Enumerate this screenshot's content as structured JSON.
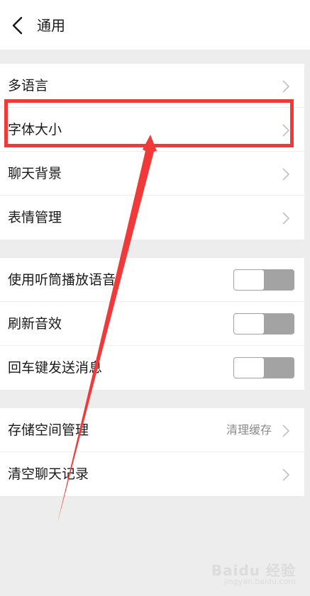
{
  "header": {
    "title": "通用",
    "back_icon": "chevron-left-icon"
  },
  "group1": {
    "items": [
      {
        "label": "多语言",
        "icon": "chevron-right-icon"
      },
      {
        "label": "字体大小",
        "icon": "chevron-right-icon"
      },
      {
        "label": "聊天背景",
        "icon": "chevron-right-icon"
      },
      {
        "label": "表情管理",
        "icon": "chevron-right-icon"
      }
    ]
  },
  "group2": {
    "items": [
      {
        "label": "使用听筒播放语音",
        "toggle_on": false
      },
      {
        "label": "刷新音效",
        "toggle_on": false
      },
      {
        "label": "回车键发送消息",
        "toggle_on": false
      }
    ]
  },
  "group3": {
    "items": [
      {
        "label": "存储空间管理",
        "value": "清理缓存",
        "icon": "chevron-right-icon"
      },
      {
        "label": "清空聊天记录",
        "icon": "chevron-right-icon"
      }
    ]
  },
  "annotation": {
    "highlight_color": "#f03a3a"
  },
  "watermark": {
    "main": "Baidu 经验",
    "sub": "jingyan.baidu.com"
  }
}
